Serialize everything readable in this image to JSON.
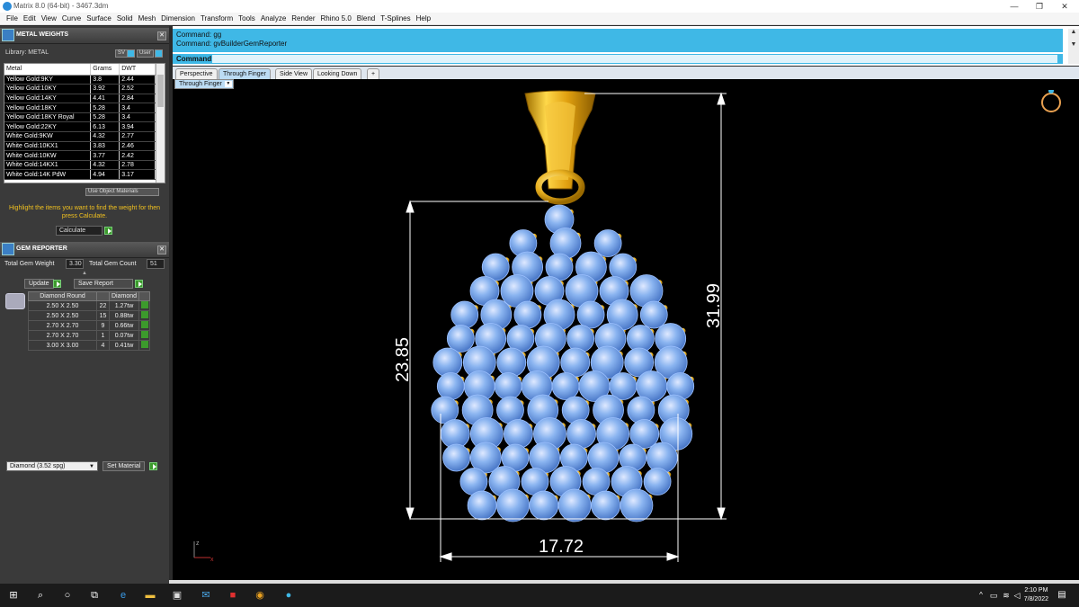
{
  "window": {
    "title": "Matrix 8.0 (64-bit) - 3467.3dm",
    "min": "—",
    "max": "❐",
    "close": "✕"
  },
  "menu": [
    "File",
    "Edit",
    "View",
    "Curve",
    "Surface",
    "Solid",
    "Mesh",
    "Dimension",
    "Transform",
    "Tools",
    "Analyze",
    "Render",
    "Rhino 5.0",
    "Blend",
    "T-Splines",
    "Help"
  ],
  "metal_weights": {
    "title": "METAL WEIGHTS",
    "library_label": "Library: METAL",
    "sv_label": "SV",
    "user_label": "User",
    "columns": [
      "Metal",
      "Grams",
      "DWT"
    ],
    "rows": [
      [
        "Yellow Gold:9KY",
        "3.8",
        "2.44"
      ],
      [
        "Yellow Gold:10KY",
        "3.92",
        "2.52"
      ],
      [
        "Yellow Gold:14KY",
        "4.41",
        "2.84"
      ],
      [
        "Yellow Gold:18KY",
        "5.28",
        "3.4"
      ],
      [
        "Yellow Gold:18KY Royal",
        "5.28",
        "3.4"
      ],
      [
        "Yellow Gold:22KY",
        "6.13",
        "3.94"
      ],
      [
        "White Gold:9KW",
        "4.32",
        "2.77"
      ],
      [
        "White Gold:10KX1",
        "3.83",
        "2.46"
      ],
      [
        "White Gold:10KW",
        "3.77",
        "2.42"
      ],
      [
        "White Gold:14KX1",
        "4.32",
        "2.78"
      ],
      [
        "White Gold:14K PdW",
        "4.94",
        "3.17"
      ]
    ],
    "use_object_materials": "Use Object Materials",
    "hint": "Highlight the items you want to find the weight for then press Calculate.",
    "calculate_label": "Calculate"
  },
  "gem_reporter": {
    "title": "GEM REPORTER",
    "total_weight_label": "Total Gem Weight",
    "total_weight": "3.30",
    "total_count_label": "Total Gem Count",
    "total_count": "51",
    "update_label": "Update",
    "save_report_label": "Save Report",
    "columns": [
      "Diamond Round",
      "",
      "Diamond"
    ],
    "rows": [
      [
        "2.50 X 2.50",
        "22",
        "1.27tw"
      ],
      [
        "2.50 X 2.50",
        "15",
        "0.88tw"
      ],
      [
        "2.70 X 2.70",
        "9",
        "0.66tw"
      ],
      [
        "2.70 X 2.70",
        "1",
        "0.07tw"
      ],
      [
        "3.00 X 3.00",
        "4",
        "0.41tw"
      ]
    ],
    "material_select": "Diamond    (3.52 spg)",
    "set_material_label": "Set Material"
  },
  "command": {
    "history": [
      "Command: gg",
      "Command: gvBuilderGemReporter"
    ],
    "prompt": "Command:"
  },
  "tabs": [
    "Perspective",
    "Through Finger",
    "Side View",
    "Looking Down",
    "+"
  ],
  "active_tab": "Through Finger",
  "viewport": {
    "title": "Through Finger",
    "dim_height_left": "23.85",
    "dim_height_right": "31.99",
    "dim_width": "17.72",
    "gizmo_y": "z",
    "gizmo_x": "x",
    "colors": {
      "background": "#000000",
      "gem": "#8ab4f0",
      "gold": "#e8b020",
      "dimension": "#ffffff"
    }
  },
  "taskbar": {
    "time": "2:10 PM",
    "date": "7/8/2022"
  }
}
